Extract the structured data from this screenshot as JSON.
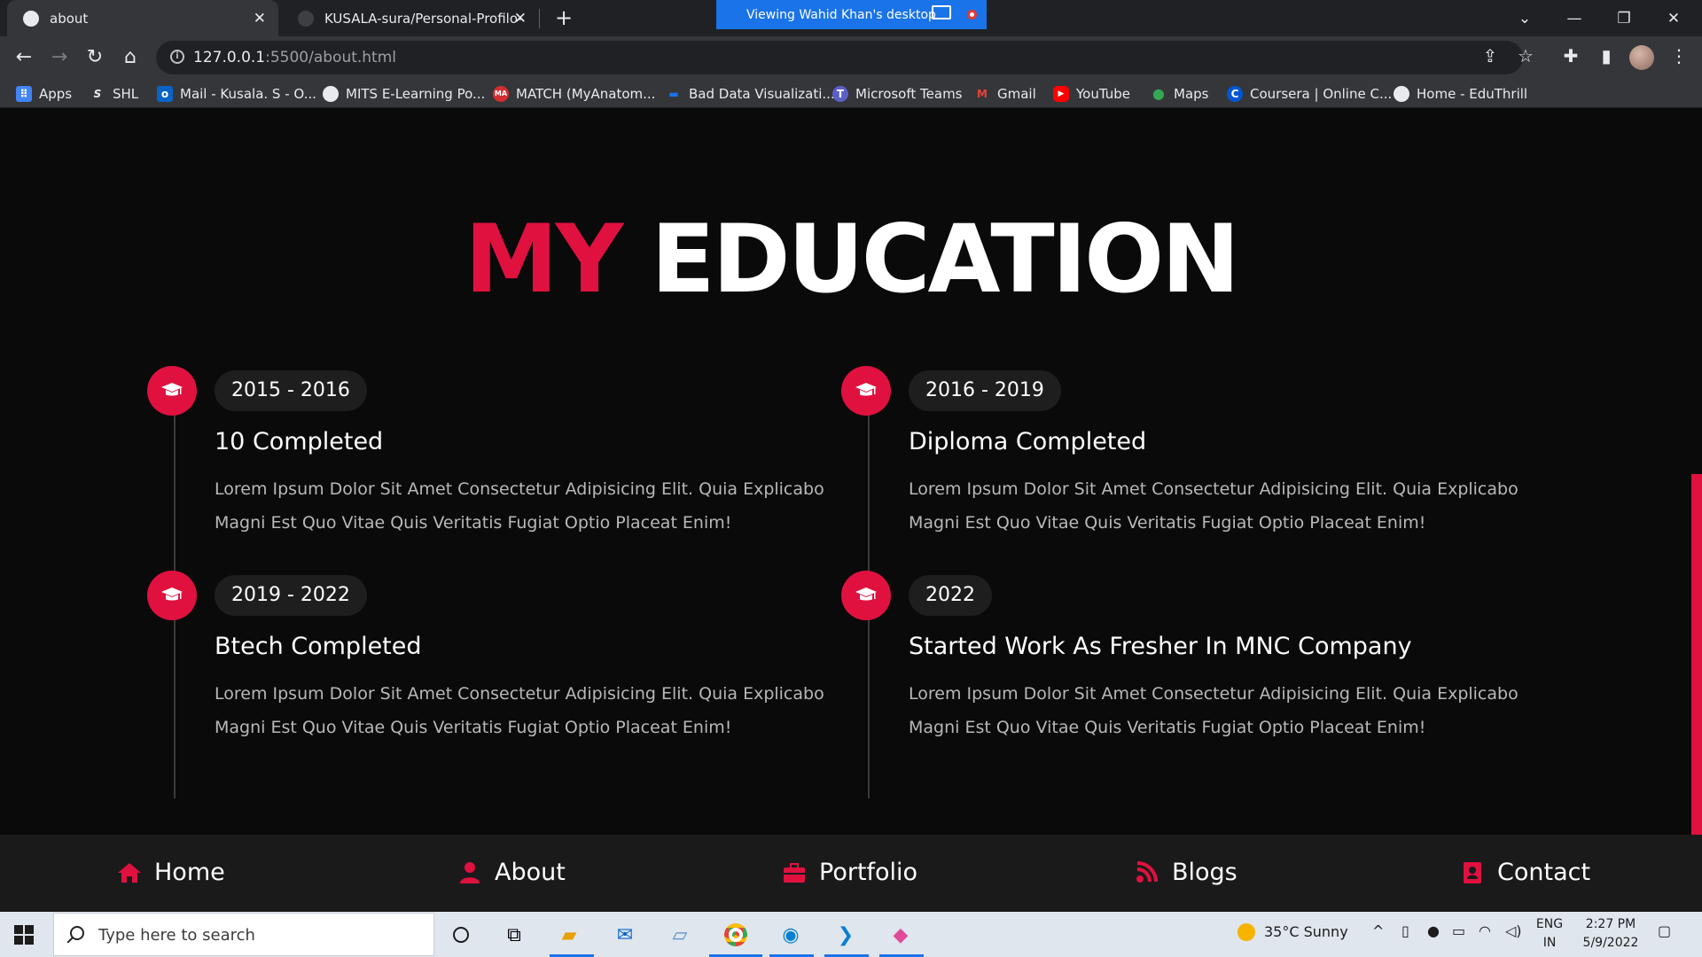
{
  "browser": {
    "tabs": [
      {
        "title": "about",
        "active": true
      },
      {
        "title": "KUSALA-sura/Personal-Profilo-Fo",
        "active": false
      }
    ],
    "share_banner": "Viewing Wahid Khan's desktop",
    "url_host": "127.0.0.1",
    "url_rest": ":5500/about.html",
    "bookmarks": [
      {
        "label": "Apps",
        "icon": "apps-grid-icon",
        "color": "#4285f4"
      },
      {
        "label": "SHL",
        "icon": "shl-icon",
        "color": "#9aa0a6"
      },
      {
        "label": "Mail - Kusala. S - O...",
        "icon": "outlook-icon",
        "color": "#0a64c8"
      },
      {
        "label": "MITS E-Learning Po...",
        "icon": "globe-icon",
        "color": "#9aa0a6"
      },
      {
        "label": "MATCH (MyAnatom...",
        "icon": "match-icon",
        "color": "#d32f2f"
      },
      {
        "label": "Bad Data Visualizati...",
        "icon": "bookmark-dash-icon",
        "color": "#1a73e8"
      },
      {
        "label": "Microsoft Teams",
        "icon": "teams-icon",
        "color": "#5b5fc7"
      },
      {
        "label": "Gmail",
        "icon": "gmail-icon",
        "color": "#ea4335"
      },
      {
        "label": "YouTube",
        "icon": "youtube-icon",
        "color": "#ff0000"
      },
      {
        "label": "Maps",
        "icon": "maps-icon",
        "color": "#34a853"
      },
      {
        "label": "Coursera | Online C...",
        "icon": "coursera-icon",
        "color": "#0056d2"
      },
      {
        "label": "Home - EduThrill",
        "icon": "eduthrill-icon",
        "color": "#9aa0a6"
      }
    ]
  },
  "page": {
    "heading_red": "MY",
    "heading_white": "EDUCATION",
    "accent_color": "#e0113f",
    "education": [
      {
        "year": "2015 - 2016",
        "title": "10 Completed",
        "desc": "Lorem Ipsum Dolor Sit Amet Consectetur Adipisicing Elit. Quia Explicabo Magni Est Quo Vitae Quis Veritatis Fugiat Optio Placeat Enim!"
      },
      {
        "year": "2016 - 2019",
        "title": "Diploma Completed",
        "desc": "Lorem Ipsum Dolor Sit Amet Consectetur Adipisicing Elit. Quia Explicabo Magni Est Quo Vitae Quis Veritatis Fugiat Optio Placeat Enim!"
      },
      {
        "year": "2019 - 2022",
        "title": "Btech Completed",
        "desc": "Lorem Ipsum Dolor Sit Amet Consectetur Adipisicing Elit. Quia Explicabo Magni Est Quo Vitae Quis Veritatis Fugiat Optio Placeat Enim!"
      },
      {
        "year": "2022",
        "title": "Started Work As Fresher In MNC Company",
        "desc": "Lorem Ipsum Dolor Sit Amet Consectetur Adipisicing Elit. Quia Explicabo Magni Est Quo Vitae Quis Veritatis Fugiat Optio Placeat Enim!"
      }
    ],
    "footer_nav": [
      {
        "label": "Home",
        "icon": "home-icon"
      },
      {
        "label": "About",
        "icon": "user-icon"
      },
      {
        "label": "Portfolio",
        "icon": "briefcase-icon"
      },
      {
        "label": "Blogs",
        "icon": "blog-rss-icon"
      },
      {
        "label": "Contact",
        "icon": "address-book-icon"
      }
    ]
  },
  "taskbar": {
    "search_placeholder": "Type here to search",
    "weather": "35°C  Sunny",
    "lang_top": "ENG",
    "lang_bottom": "IN",
    "time": "2:27 PM",
    "date": "5/9/2022"
  }
}
